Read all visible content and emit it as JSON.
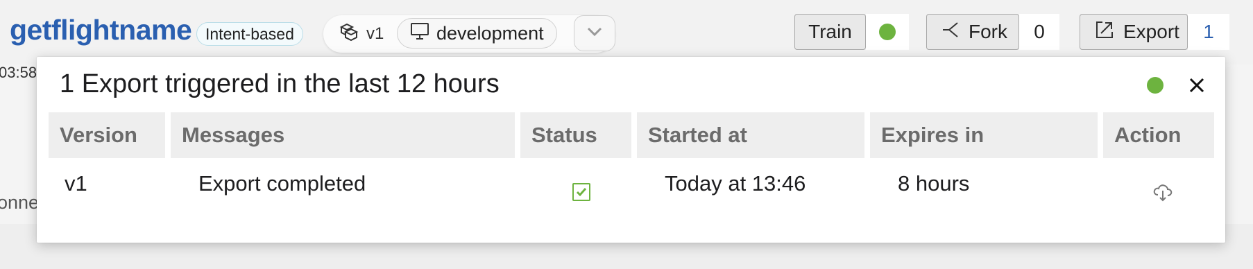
{
  "app": {
    "name": "getflightname",
    "badge": "Intent-based"
  },
  "version_selector": {
    "version": "v1",
    "environment": "development"
  },
  "toolbar": {
    "train_label": "Train",
    "fork_label": "Fork",
    "fork_count": "0",
    "export_label": "Export",
    "export_count": "1"
  },
  "background_fragments": {
    "time_fragment": "03:58",
    "row_fragment": "onne"
  },
  "export_panel": {
    "title": "1 Export triggered in the last 12 hours",
    "status_color": "#6db33f",
    "columns": [
      "Version",
      "Messages",
      "Status",
      "Started at",
      "Expires in",
      "Action"
    ],
    "rows": [
      {
        "version": "v1",
        "message": "Export completed",
        "status": "completed",
        "started_at": "Today at 13:46",
        "expires_in": "8 hours",
        "action": "download-icon"
      }
    ]
  },
  "colors": {
    "brand_blue": "#2a5fb0",
    "success_green": "#6db33f"
  },
  "icons": {
    "version_icon": "version-stack-icon",
    "environment_icon": "monitor-icon",
    "dropdown_icon": "chevron-down-icon",
    "fork_icon": "fork-icon",
    "export_icon": "export-icon",
    "close_icon": "close-icon"
  }
}
